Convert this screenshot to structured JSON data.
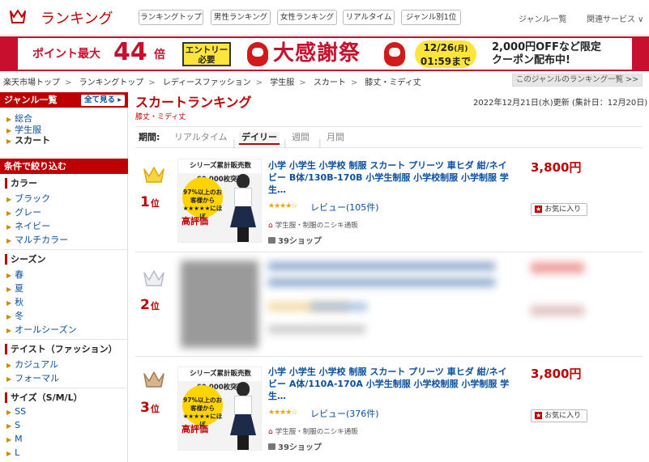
{
  "header": {
    "title": "ランキング",
    "nav": [
      "ランキングトップ",
      "男性ランキング",
      "女性ランキング",
      "リアルタイム",
      "ジャンル別1位"
    ],
    "genre_list": "ジャンル一覧",
    "related": "関連サービス ∨"
  },
  "banner": {
    "point": "ポイント最大",
    "num": "44",
    "bai": "倍",
    "entry": "エントリー 必要",
    "fest": "大感謝祭",
    "date1": "12/26",
    "date1b": "(月)",
    "date2": "01:59まで",
    "off1": "2,000円OFFなど限定",
    "off2": "クーポン配布中!"
  },
  "breadcrumb": [
    "楽天市場トップ",
    "ランキングトップ",
    "レディースファッション",
    "学生服",
    "スカート",
    "膝丈・ミディ丈"
  ],
  "breadcrumb_sep": ">",
  "genre_list_button": "このジャンルのランキング一覧 >>",
  "sidebar": {
    "genre_head": "ジャンル一覧",
    "see_all": "全て見る",
    "genres": [
      "総合",
      "学生服",
      "スカート"
    ],
    "filter_head": "条件で絞り込む",
    "sections": [
      {
        "title": "カラー",
        "items": [
          "ブラック",
          "グレー",
          "ネイビー",
          "マルチカラー"
        ]
      },
      {
        "title": "シーズン",
        "items": [
          "春",
          "夏",
          "秋",
          "冬",
          "オールシーズン"
        ]
      },
      {
        "title": "テイスト（ファッション）",
        "items": [
          "カジュアル",
          "フォーマル"
        ]
      },
      {
        "title": "サイズ（S/M/L）",
        "items": [
          "SS",
          "S",
          "M",
          "L"
        ]
      }
    ]
  },
  "main": {
    "title": "スカートランキング",
    "subtitle": "膝丈・ミディ丈",
    "updated": "2022年12月21日(水)更新 (集計日：12月20日)",
    "period_label": "期間:",
    "periods": [
      "リアルタイム",
      "デイリー",
      "週間",
      "月間"
    ],
    "active_period": "デイリー"
  },
  "items": [
    {
      "rank": "1",
      "rank_suffix": "位",
      "title": "小学 小学生 小学校 制服 スカート プリーツ 車ヒダ 紺/ネイビー B体/130B-170B 小学生制服 小学校制服 小学制服 学生…",
      "stars": "★★★★☆",
      "review": "レビュー(105件)",
      "shop": "学生服・制服のニシキ通販",
      "shop39": "39ショップ",
      "price": "3,800円",
      "fav": "お気に入り",
      "thumb_top": "シリーズ累計販売数60,000枚突破",
      "thumb_mid": "97%以上のお客様から★★★★★にほぼ",
      "thumb_big": "高評価"
    },
    {
      "rank": "2",
      "rank_suffix": "位"
    },
    {
      "rank": "3",
      "rank_suffix": "位",
      "title": "小学 小学生 小学校 制服 スカート プリーツ 車ヒダ 紺/ネイビー A体/110A-170A 小学生制服 小学校制服 小学制服 学生…",
      "stars": "★★★★☆",
      "review": "レビュー(376件)",
      "shop": "学生服・制服のニシキ通販",
      "shop39": "39ショップ",
      "price": "3,800円",
      "fav": "お気に入り",
      "thumb_top": "シリーズ累計販売数60,000枚突破",
      "thumb_mid": "97%以上のお客様から★★★★★にほぼ",
      "thumb_big": "高評価"
    }
  ],
  "colors": {
    "accent": "#bf0000",
    "link": "#0a4fa0",
    "gold": "#f0c000",
    "silver": "#c8ccd0",
    "bronze": "#a67c52"
  }
}
